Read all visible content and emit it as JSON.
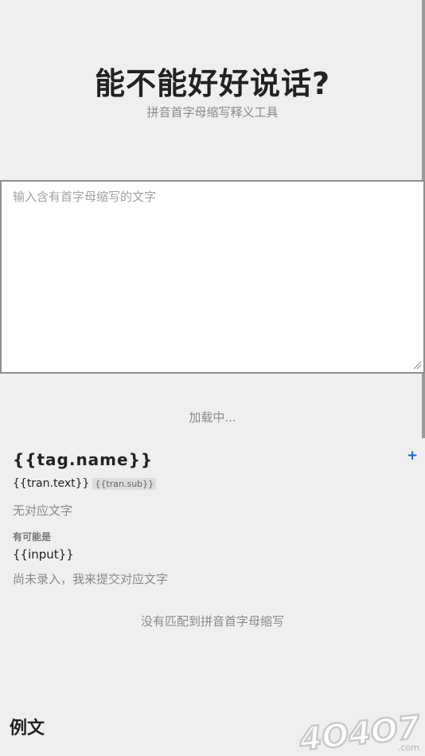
{
  "header": {
    "title": "能不能好好说话?",
    "subtitle": "拼音首字母缩写释义工具"
  },
  "input": {
    "placeholder": "输入含有首字母缩写的文字"
  },
  "status": {
    "loading": "加载中..."
  },
  "result": {
    "tag_name": "{{tag.name}}",
    "add_symbol": "+",
    "tran_text": "{{tran.text}}",
    "tran_sub": "{{tran.sub}}",
    "no_text": "无对应文字",
    "maybe_label": "有可能是",
    "input_value": "{{input}}",
    "submit_text": "尚未录入，我来提交对应文字"
  },
  "empty": {
    "no_match": "没有匹配到拼音首字母缩写"
  },
  "example": {
    "heading": "例文"
  },
  "watermark": {
    "text": "4O4O7",
    "suffix": ".com"
  },
  "colors": {
    "background": "#efefef",
    "accent": "#1a63d8",
    "muted": "#8a8a8a"
  }
}
